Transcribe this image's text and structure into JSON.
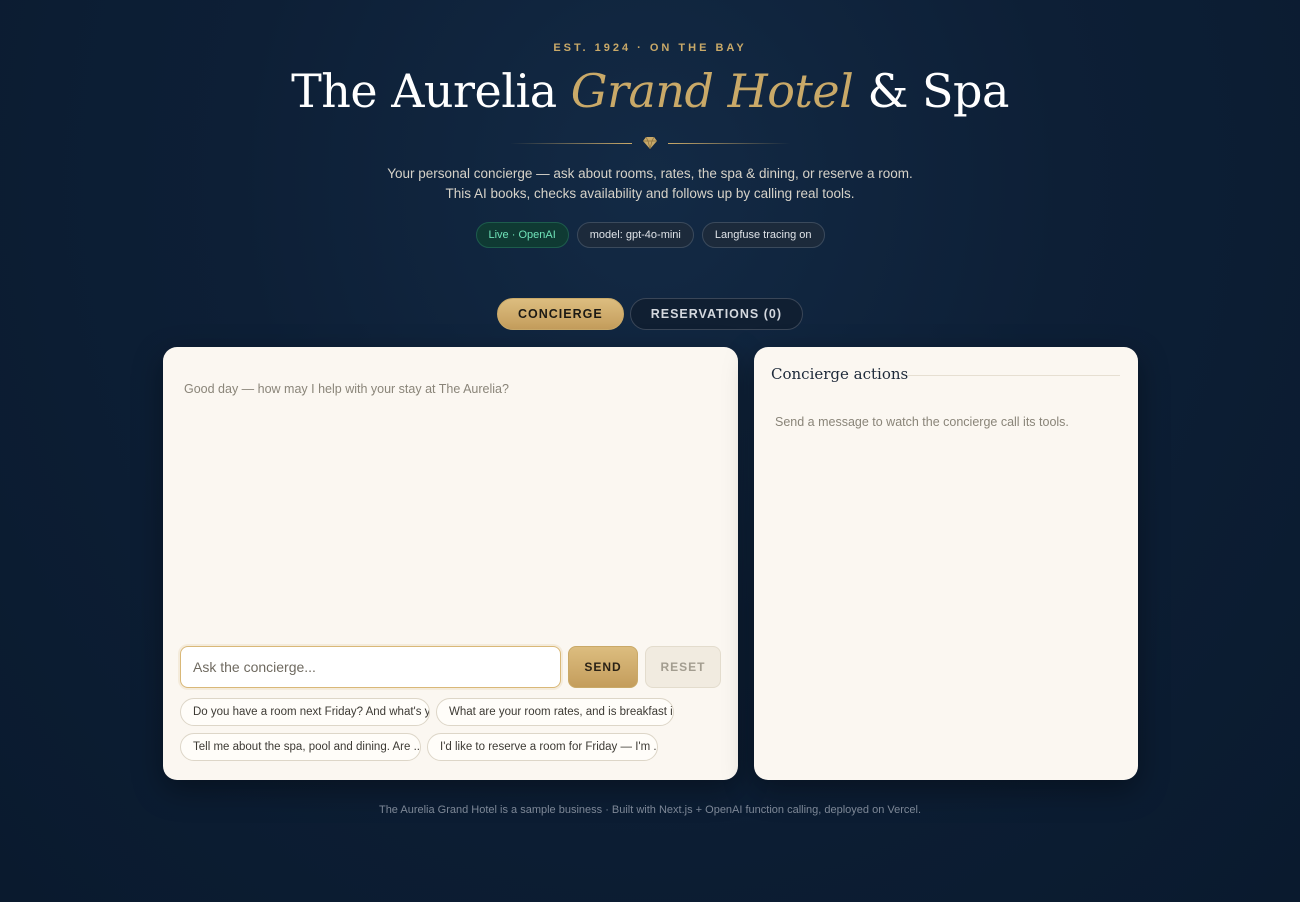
{
  "header": {
    "eyebrow": "EST. 1924 · ON THE BAY",
    "title_part1": "The Aurelia ",
    "title_gold": "Grand Hotel",
    "title_part2": " & Spa",
    "subtitle_line1": "Your personal concierge — ask about rooms, rates, the spa & dining, or reserve a room.",
    "subtitle_line2": "This AI books, checks availability and follows up by calling real tools.",
    "divider_icon": "diamond-icon"
  },
  "badges": {
    "live": "Live · OpenAI",
    "model": "model: gpt-4o-mini",
    "tracing": "Langfuse tracing on"
  },
  "tabs": {
    "concierge": "CONCIERGE",
    "reservations": "RESERVATIONS (0)"
  },
  "chat": {
    "greeting": "Good day — how may I help with your stay at The Aurelia?",
    "input_placeholder": "Ask the concierge...",
    "send_label": "SEND",
    "reset_label": "RESET",
    "suggestions": [
      "Do you have a room next Friday? And what's y...",
      "What are your room rates, and is breakfast i...",
      "Tell me about the spa, pool and dining. Are ...",
      "I'd like to reserve a room for Friday — I'm ..."
    ]
  },
  "actions": {
    "title": "Concierge actions",
    "empty_text": "Send a message to watch the concierge call its tools."
  },
  "footer": {
    "text": "The Aurelia Grand Hotel is a sample business · Built with Next.js + OpenAI function calling, deployed on Vercel."
  },
  "colors": {
    "background": "#0d1f36",
    "gold": "#c9a968",
    "panel": "#fbf7f1",
    "live_badge": "#6fe3b8"
  }
}
